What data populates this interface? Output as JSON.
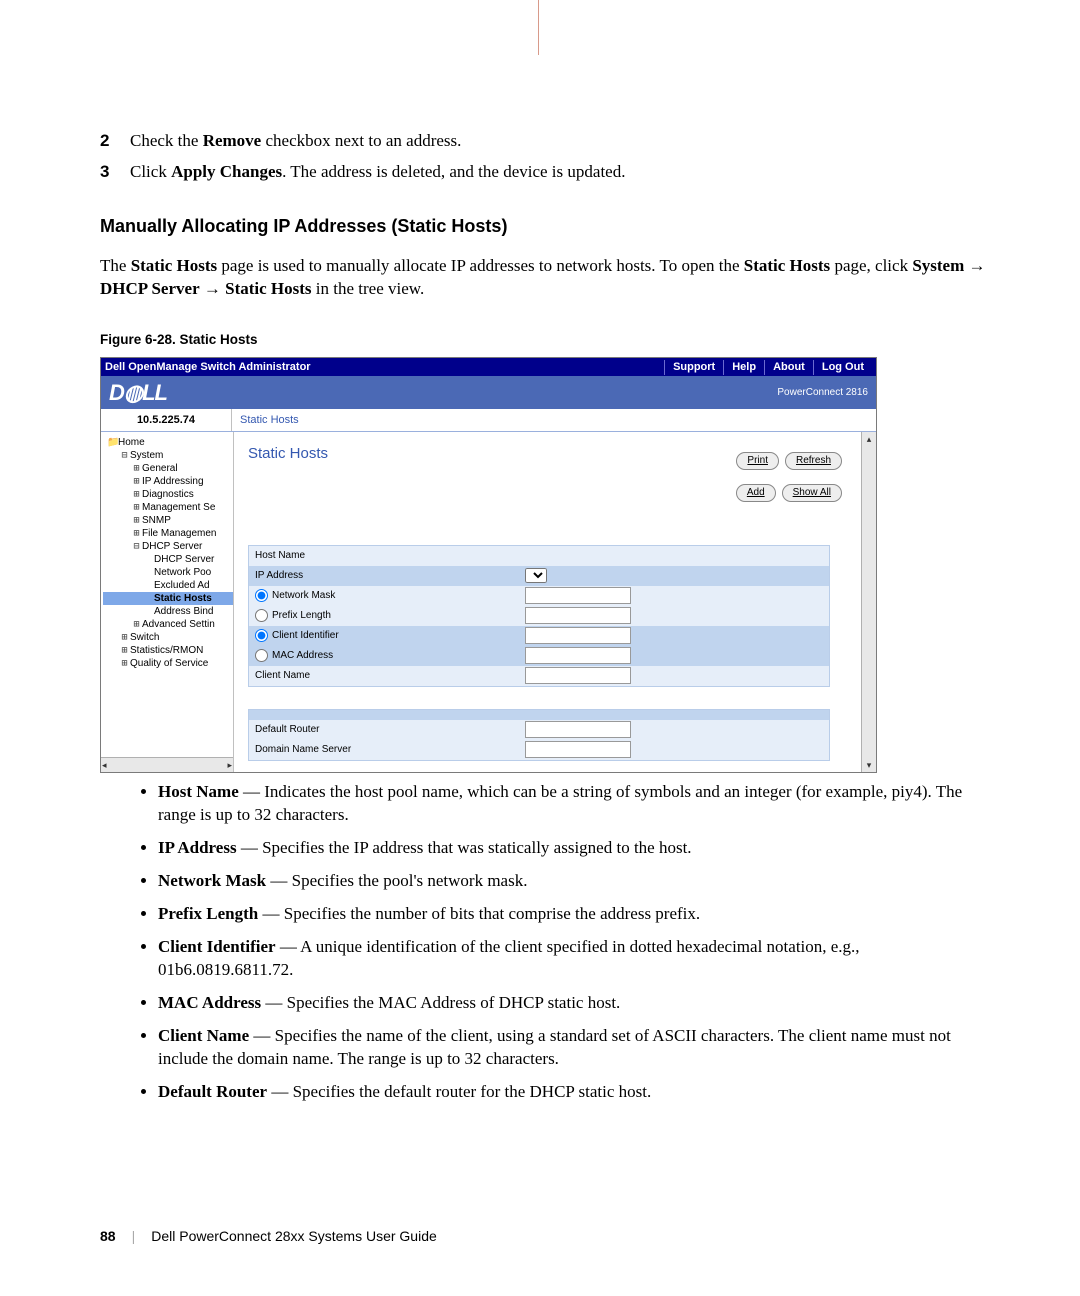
{
  "page": {
    "number": "88",
    "guide": "Dell PowerConnect 28xx Systems User Guide"
  },
  "steps": [
    {
      "n": "2",
      "pre": "Check the ",
      "bold": "Remove",
      "post": " checkbox next to an address."
    },
    {
      "n": "3",
      "pre": "Click ",
      "bold": "Apply Changes",
      "post": ". The address is deleted, and the device is updated."
    }
  ],
  "section_title": "Manually Allocating IP Addresses (Static Hosts)",
  "section_para_1": "The ",
  "section_para_bold1": "Static Hosts",
  "section_para_2": " page is used to manually allocate IP addresses to network hosts. To open the ",
  "section_para_bold2": "Static Hosts",
  "section_para_3": " page, click ",
  "section_para_bold3": "System",
  "section_arrow": " → ",
  "section_para_bold4": "DHCP Server",
  "section_para_bold5": "Static Hosts",
  "section_para_4": " in the tree view.",
  "fig_caption": "Figure 6-28.    Static Hosts",
  "screenshot": {
    "title": "Dell OpenManage Switch Administrator",
    "nav": {
      "support": "Support",
      "help": "Help",
      "about": "About",
      "logout": "Log Out"
    },
    "brand": "D◍LL",
    "product": "PowerConnect 2816",
    "ip": "10.5.225.74",
    "breadcrumb": "Static Hosts",
    "content_title": "Static Hosts",
    "buttons": {
      "print": "Print",
      "refresh": "Refresh",
      "add": "Add",
      "showall": "Show All"
    },
    "tree": [
      {
        "indent": 0,
        "icon": "📁",
        "label": "Home"
      },
      {
        "indent": 1,
        "icon": "⊟",
        "label": "System"
      },
      {
        "indent": 2,
        "icon": "⊞",
        "label": "General"
      },
      {
        "indent": 2,
        "icon": "⊞",
        "label": "IP Addressing"
      },
      {
        "indent": 2,
        "icon": "⊞",
        "label": "Diagnostics"
      },
      {
        "indent": 2,
        "icon": "⊞",
        "label": "Management Se"
      },
      {
        "indent": 2,
        "icon": "⊞",
        "label": "SNMP"
      },
      {
        "indent": 2,
        "icon": "⊞",
        "label": "File Managemen"
      },
      {
        "indent": 2,
        "icon": "⊟",
        "label": "DHCP Server"
      },
      {
        "indent": 3,
        "icon": "",
        "label": "DHCP Server"
      },
      {
        "indent": 3,
        "icon": "",
        "label": "Network Poo"
      },
      {
        "indent": 3,
        "icon": "",
        "label": "Excluded Ad"
      },
      {
        "indent": 3,
        "icon": "",
        "label": "Static Hosts",
        "selected": true
      },
      {
        "indent": 3,
        "icon": "",
        "label": "Address Bind"
      },
      {
        "indent": 2,
        "icon": "⊞",
        "label": "Advanced Settin"
      },
      {
        "indent": 1,
        "icon": "⊞",
        "label": "Switch"
      },
      {
        "indent": 1,
        "icon": "⊞",
        "label": "Statistics/RMON"
      },
      {
        "indent": 1,
        "icon": "⊞",
        "label": "Quality of Service"
      }
    ],
    "form1": {
      "host_name": "Host Name",
      "ip_address": "IP Address",
      "network_mask": "Network Mask",
      "prefix_length": "Prefix Length",
      "client_identifier": "Client Identifier",
      "mac_address": "MAC Address",
      "client_name": "Client Name"
    },
    "form2": {
      "default_router": "Default Router",
      "domain_name_server": "Domain Name Server"
    }
  },
  "bullets": [
    {
      "term": "Host Name",
      "desc": " — Indicates the host pool name, which can be a string of symbols and an integer (for example, piy4). The range is up to 32 characters."
    },
    {
      "term": "IP Address",
      "desc": " — Specifies the IP address that was statically assigned to the host."
    },
    {
      "term": "Network Mask",
      "desc": " — Specifies the pool's network mask."
    },
    {
      "term": "Prefix Length",
      "desc": " — Specifies the number of bits that comprise the address prefix."
    },
    {
      "term": "Client Identifier",
      "desc": " — A unique identification of the client specified in dotted hexadecimal notation, e.g., 01b6.0819.6811.72."
    },
    {
      "term": "MAC Address",
      "desc": " — Specifies the MAC Address of DHCP static host."
    },
    {
      "term": "Client Name",
      "desc": " — Specifies the name of the client, using a standard set of ASCII characters. The client name must not include the domain name. The range is up to 32 characters."
    },
    {
      "term": "Default Router",
      "desc": " — Specifies the default router for the DHCP static host."
    }
  ]
}
